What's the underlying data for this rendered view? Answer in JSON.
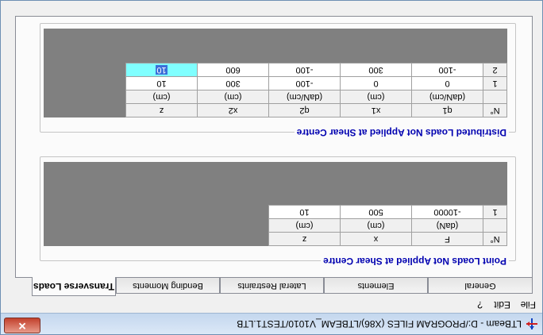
{
  "window": {
    "title": "LTBeam - D:/PROGRAM FILES (X86)/LTBEAM_V1010/TEST1.LTB",
    "close_glyph": "✕"
  },
  "menu": [
    "File",
    "Edit",
    "?"
  ],
  "tabs": [
    {
      "label": "General",
      "active": false
    },
    {
      "label": "Elements",
      "active": false
    },
    {
      "label": "Lateral Restraints",
      "active": false
    },
    {
      "label": "Bending Moments",
      "active": false
    },
    {
      "label": "Transverse Loads",
      "active": true
    }
  ],
  "point_loads": {
    "title": "Point Loads Not Applied at Shear Centre",
    "headers": [
      "N°",
      "F",
      "x",
      "z"
    ],
    "units": [
      "",
      "(daN)",
      "(cm)",
      "(cm)"
    ],
    "rows": [
      [
        "1",
        "-10000",
        "500",
        "10"
      ]
    ]
  },
  "distributed_loads": {
    "title": "Distributed Loads Not Applied at Shear Centre",
    "headers": [
      "N°",
      "q1",
      "x1",
      "q2",
      "x2",
      "z"
    ],
    "units": [
      "",
      "(daN/cm)",
      "(cm)",
      "(daN/cm)",
      "(cm)",
      "(cm)"
    ],
    "rows": [
      [
        "1",
        "0",
        "0",
        "-100",
        "300",
        "10"
      ],
      [
        "2",
        "-100",
        "300",
        "-100",
        "600",
        "10"
      ]
    ],
    "selected_cell": {
      "row": 1,
      "col": 5
    }
  },
  "icons": {
    "app": "ltbeam-app-icon"
  }
}
